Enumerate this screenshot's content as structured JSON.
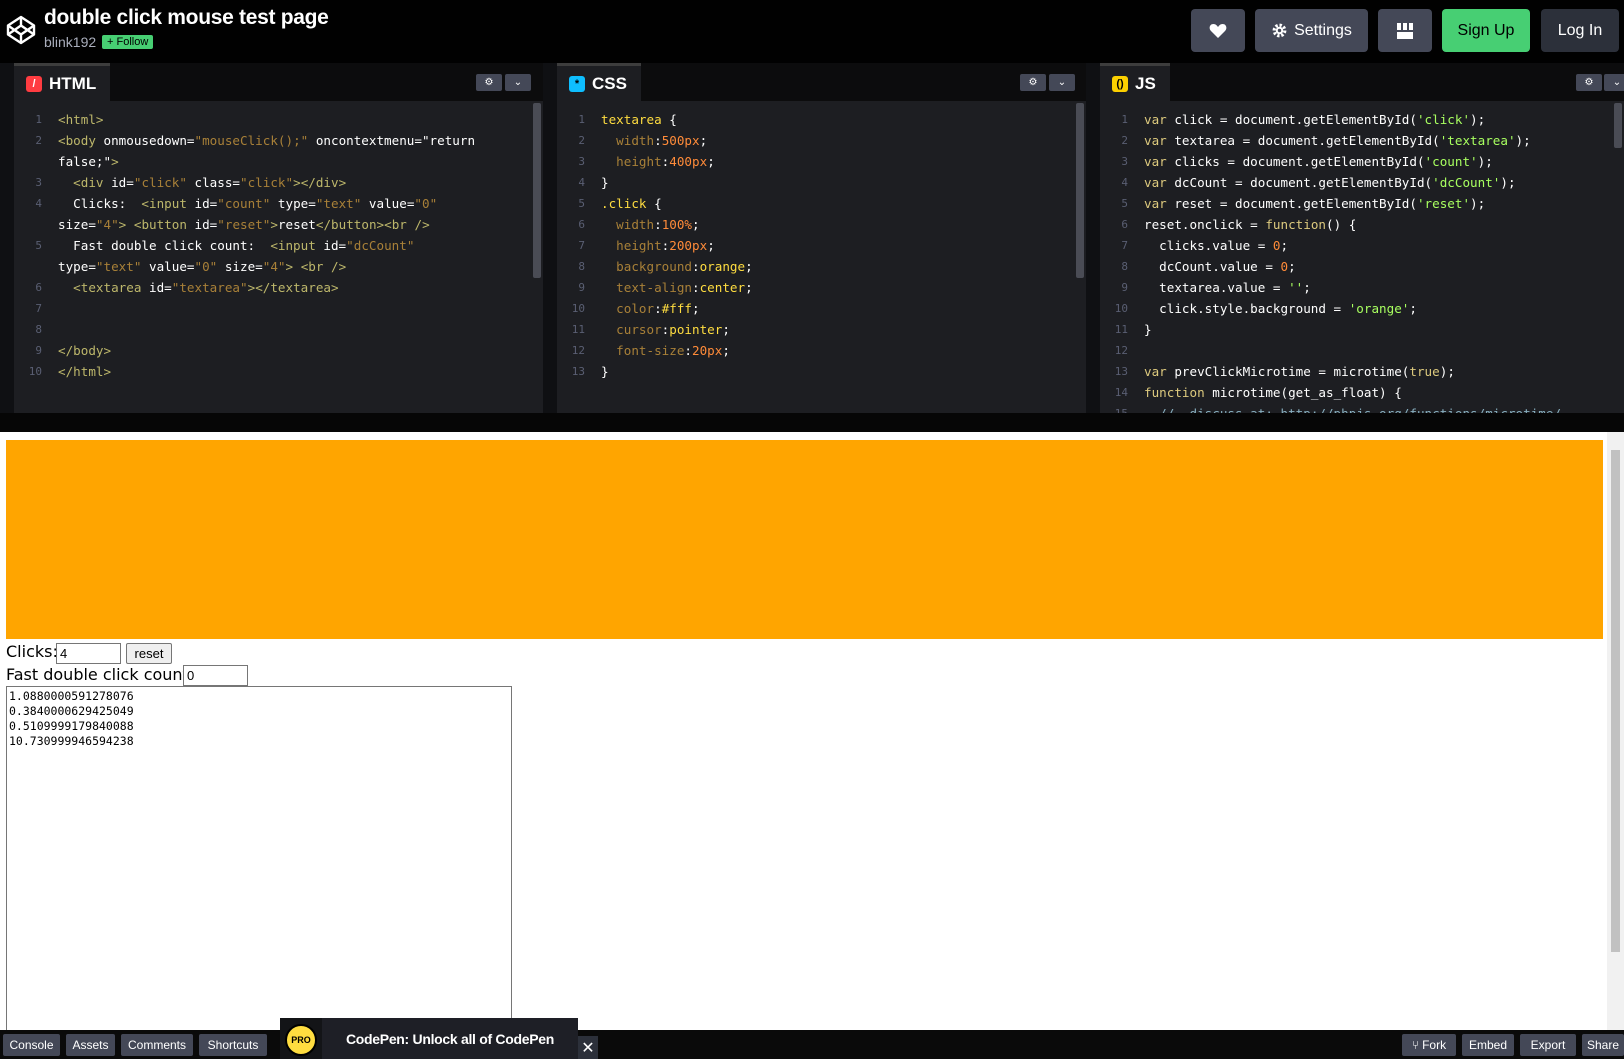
{
  "header": {
    "title": "double click mouse test page",
    "author": "blink192",
    "follow_label": "+ Follow",
    "heart_icon": "heart-icon",
    "settings_label": "Settings",
    "layout_icon": "layout-icon",
    "signup_label": "Sign Up",
    "login_label": "Log In"
  },
  "editors": {
    "html": {
      "tab": "HTML",
      "lines": [
        {
          "n": "1",
          "code": "<html>"
        },
        {
          "n": "2",
          "code": "<body onmousedown=\"mouseClick();\" oncontextmenu=\"return"
        },
        {
          "n": "",
          "code": "false;\">"
        },
        {
          "n": "3",
          "code": "  <div id=\"click\" class=\"click\"></div>"
        },
        {
          "n": "4",
          "code": "  Clicks:  <input id=\"count\" type=\"text\" value=\"0\""
        },
        {
          "n": "",
          "code": "size=\"4\"> <button id=\"reset\">reset</button><br />"
        },
        {
          "n": "5",
          "code": "  Fast double click count:  <input id=\"dcCount\""
        },
        {
          "n": "",
          "code": "type=\"text\" value=\"0\" size=\"4\"> <br />"
        },
        {
          "n": "6",
          "code": "  <textarea id=\"textarea\"></textarea>"
        },
        {
          "n": "7",
          "code": ""
        },
        {
          "n": "8",
          "code": ""
        },
        {
          "n": "9",
          "code": "</body>"
        },
        {
          "n": "10",
          "code": "</html>"
        }
      ]
    },
    "css": {
      "tab": "CSS",
      "lines": [
        {
          "n": "1",
          "code": "textarea {"
        },
        {
          "n": "2",
          "code": "  width:500px;"
        },
        {
          "n": "3",
          "code": "  height:400px;"
        },
        {
          "n": "4",
          "code": "}"
        },
        {
          "n": "5",
          "code": ".click {"
        },
        {
          "n": "6",
          "code": "  width:100%;"
        },
        {
          "n": "7",
          "code": "  height:200px;"
        },
        {
          "n": "8",
          "code": "  background:orange;"
        },
        {
          "n": "9",
          "code": "  text-align:center;"
        },
        {
          "n": "10",
          "code": "  color:#fff;"
        },
        {
          "n": "11",
          "code": "  cursor:pointer;"
        },
        {
          "n": "12",
          "code": "  font-size:20px;"
        },
        {
          "n": "13",
          "code": "}"
        }
      ]
    },
    "js": {
      "tab": "JS",
      "lines": [
        {
          "n": "1",
          "code": "var click = document.getElementById('click');"
        },
        {
          "n": "2",
          "code": "var textarea = document.getElementById('textarea');"
        },
        {
          "n": "3",
          "code": "var clicks = document.getElementById('count');"
        },
        {
          "n": "4",
          "code": "var dcCount = document.getElementById('dcCount');"
        },
        {
          "n": "5",
          "code": "var reset = document.getElementById('reset');"
        },
        {
          "n": "6",
          "code": "reset.onclick = function() {"
        },
        {
          "n": "7",
          "code": "  clicks.value = 0;"
        },
        {
          "n": "8",
          "code": "  dcCount.value = 0;"
        },
        {
          "n": "9",
          "code": "  textarea.value = '';"
        },
        {
          "n": "10",
          "code": "  click.style.background = 'orange';"
        },
        {
          "n": "11",
          "code": "}"
        },
        {
          "n": "12",
          "code": ""
        },
        {
          "n": "13",
          "code": "var prevClickMicrotime = microtime(true);"
        },
        {
          "n": "14",
          "code": "function microtime(get_as_float) {"
        },
        {
          "n": "15",
          "code": "  //  discuss at: http://phpjs.org/functions/microtime/"
        }
      ]
    }
  },
  "preview": {
    "clicks_label": "Clicks:",
    "clicks_value": "4",
    "reset_label": "reset",
    "dc_label": "Fast double click count:",
    "dc_value": "0",
    "textarea_lines": [
      "1.0880000591278076",
      "0.3840000629425049",
      "0.5109999179840088",
      "10.730999946594238"
    ]
  },
  "footer": {
    "console": "Console",
    "assets": "Assets",
    "comments": "Comments",
    "shortcuts": "Shortcuts",
    "promo_badge": "PRO",
    "promo_text": "CodePen: Unlock all of CodePen",
    "close": "✕",
    "fork": "Fork",
    "embed": "Embed",
    "export": "Export",
    "share": "Share"
  },
  "colors": {
    "accent_green": "#47cf73",
    "preview_block": "#ffa500",
    "html_icon": "#ff3c41",
    "css_icon": "#0ebeff",
    "js_icon": "#fcd000"
  }
}
